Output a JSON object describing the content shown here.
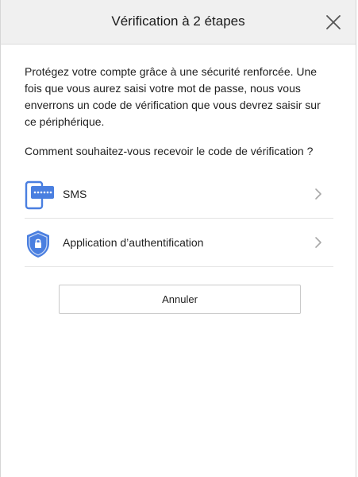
{
  "dialog": {
    "title": "Vérification à 2 étapes",
    "close_icon": "close-icon"
  },
  "body": {
    "intro": "Protégez votre compte grâce à une sécurité renforcée. Une fois que vous aurez saisi votre mot de passe, nous vous enverrons un code de vérification que vous devrez saisir sur ce périphérique.",
    "question": "Comment souhaitez-vous recevoir le code de vérification ?"
  },
  "options": [
    {
      "label": "SMS",
      "icon": "sms-phone-icon"
    },
    {
      "label": "Application d’authentification",
      "icon": "shield-lock-icon"
    }
  ],
  "actions": {
    "cancel_label": "Annuler"
  },
  "colors": {
    "accent": "#4a7fe0",
    "header_bg": "#f0f0f0",
    "divider": "#e3e3e3"
  }
}
